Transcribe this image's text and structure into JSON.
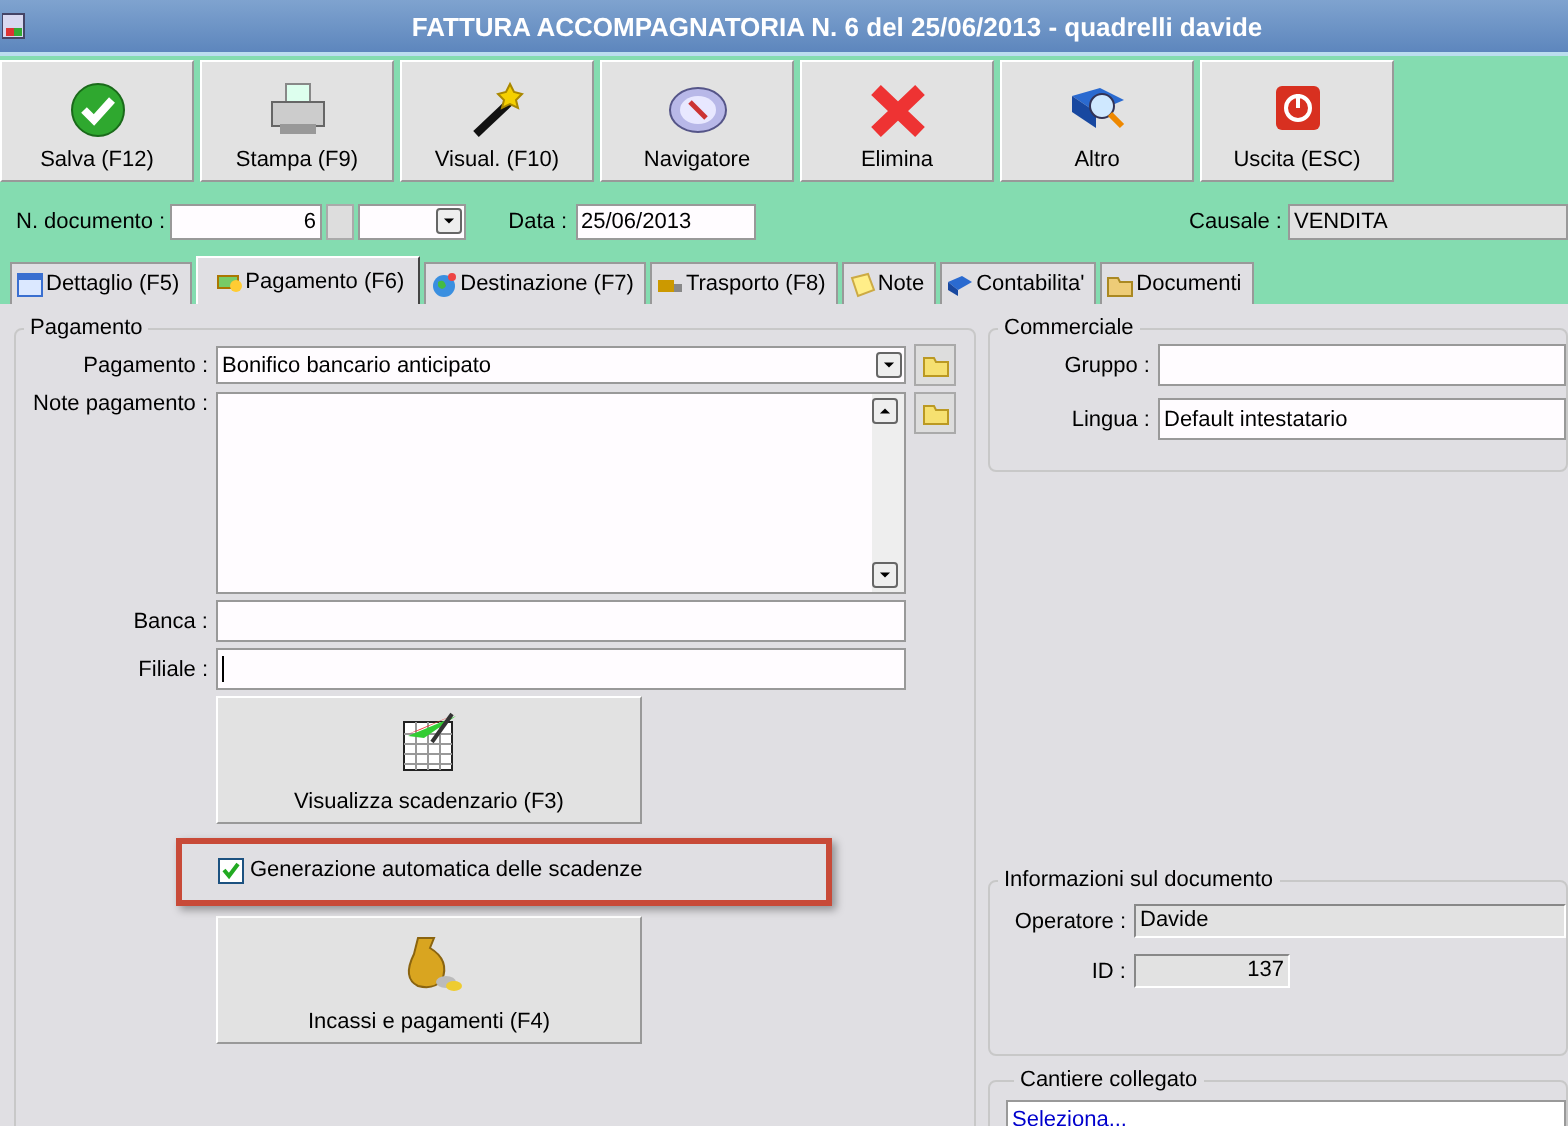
{
  "window": {
    "title": "FATTURA ACCOMPAGNATORIA N. 6 del 25/06/2013 - quadrelli davide"
  },
  "toolbar": [
    {
      "label": "Salva (F12)"
    },
    {
      "label": "Stampa (F9)"
    },
    {
      "label": "Visual. (F10)"
    },
    {
      "label": "Navigatore"
    },
    {
      "label": "Elimina"
    },
    {
      "label": "Altro"
    },
    {
      "label": "Uscita (ESC)"
    }
  ],
  "header": {
    "n_documento": {
      "label": "N. documento :",
      "value": "6"
    },
    "data": {
      "label": "Data :",
      "value": "25/06/2013"
    },
    "causale": {
      "label": "Causale :",
      "value": "VENDITA"
    }
  },
  "tabs": [
    {
      "label": "Dettaglio (F5)",
      "selected": false
    },
    {
      "label": "Pagamento (F6)",
      "selected": true
    },
    {
      "label": "Destinazione (F7)",
      "selected": false
    },
    {
      "label": "Trasporto (F8)",
      "selected": false
    },
    {
      "label": "Note",
      "selected": false
    },
    {
      "label": "Contabilita'",
      "selected": false
    },
    {
      "label": "Documenti",
      "selected": false
    }
  ],
  "pagamento": {
    "title": "Pagamento",
    "pagamento": {
      "label": "Pagamento :",
      "value": "Bonifico bancario anticipato"
    },
    "note_pagamento": {
      "label": "Note pagamento :"
    },
    "banca": {
      "label": "Banca :"
    },
    "filiale": {
      "label": "Filiale :"
    },
    "scadenzario_button": "Visualizza scadenzario (F3)",
    "auto_scadenze": {
      "label": "Generazione automatica delle scadenze",
      "checked": true
    },
    "incassi_button": "Incassi e pagamenti (F4)"
  },
  "commerciale": {
    "title": "Commerciale",
    "gruppo": {
      "label": "Gruppo :"
    },
    "lingua": {
      "label": "Lingua :",
      "value": "Default intestatario"
    }
  },
  "informazioni": {
    "title": "Informazioni sul documento",
    "operatore": {
      "label": "Operatore :",
      "value": "Davide"
    },
    "id": {
      "label": "ID :",
      "value": "137"
    }
  },
  "cantiere": {
    "title": "Cantiere collegato",
    "link": "Seleziona..."
  }
}
